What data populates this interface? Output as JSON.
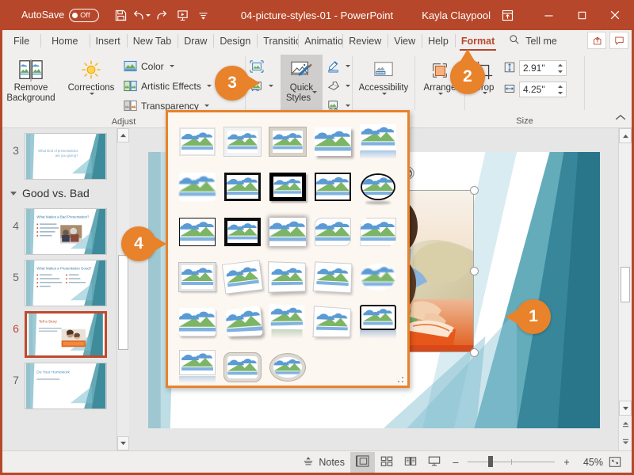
{
  "titlebar": {
    "autosave_label": "AutoSave",
    "autosave_state": "Off",
    "document_title": "04-picture-styles-01  -  PowerPoint",
    "user_name": "Kayla Claypool",
    "qat": [
      {
        "name": "save-icon",
        "label": "Save"
      },
      {
        "name": "undo-icon",
        "label": "Undo"
      },
      {
        "name": "redo-icon",
        "label": "Redo"
      },
      {
        "name": "start-slideshow-icon",
        "label": "Start From Beginning"
      },
      {
        "name": "customize-qat-icon",
        "label": "Customize Quick Access Toolbar"
      }
    ],
    "window_buttons": [
      {
        "name": "minimize-button",
        "glyph": "–"
      },
      {
        "name": "restore-button",
        "glyph": "☐"
      },
      {
        "name": "close-button",
        "glyph": "✕"
      }
    ],
    "ribbon_display_options": "ribbon-display-options-icon"
  },
  "tabs": [
    {
      "label": "File",
      "active": false
    },
    {
      "label": "Home",
      "active": false
    },
    {
      "label": "Insert",
      "active": false
    },
    {
      "label": "New Tab",
      "active": false
    },
    {
      "label": "Draw",
      "active": false
    },
    {
      "label": "Design",
      "active": false
    },
    {
      "label": "Transitions",
      "active": false
    },
    {
      "label": "Animations",
      "active": false
    },
    {
      "label": "Review",
      "active": false
    },
    {
      "label": "View",
      "active": false
    },
    {
      "label": "Help",
      "active": false
    },
    {
      "label": "Format",
      "active": true
    }
  ],
  "tellme": {
    "label": "Tell me",
    "icon": "search-icon"
  },
  "tab_right_buttons": [
    {
      "name": "share-button",
      "icon": "share-icon"
    },
    {
      "name": "comments-button",
      "icon": "comment-icon"
    }
  ],
  "ribbon": {
    "adjust": {
      "group_label": "Adjust",
      "remove_background": "Remove\nBackground",
      "remove_background_line1": "Remove",
      "remove_background_line2": "Background",
      "corrections": "Corrections",
      "items": [
        {
          "label": "Color",
          "icon": "color-icon",
          "has_caret": true
        },
        {
          "label": "Artistic Effects",
          "icon": "artistic-effects-icon",
          "has_caret": true
        },
        {
          "label": "Transparency",
          "icon": "transparency-icon",
          "has_caret": true
        }
      ]
    },
    "picture_styles": {
      "group_label": "",
      "quick_styles_line1": "Quick",
      "quick_styles_line2": "Styles",
      "left_icons": [
        {
          "name": "compress-pictures-icon"
        },
        {
          "name": "change-picture-icon"
        },
        {
          "name": "reset-picture-icon"
        }
      ],
      "right_icons": [
        {
          "name": "picture-border-icon",
          "has_caret": true
        },
        {
          "name": "picture-effects-icon",
          "has_caret": true
        },
        {
          "name": "picture-layout-icon",
          "has_caret": true
        }
      ]
    },
    "accessibility": {
      "label": "Accessibility",
      "icon": "accessibility-icon"
    },
    "arrange": {
      "label": "Arrange",
      "icon": "arrange-icon"
    },
    "size": {
      "group_label": "Size",
      "crop_label": "Crop",
      "crop_icon": "crop-icon",
      "height_value": "2.91\"",
      "height_icon": "shape-height-icon",
      "width_value": "4.25\"",
      "width_icon": "shape-width-icon",
      "dialog_launcher": "size-dialog-launcher"
    },
    "collapse_ribbon": "collapse-ribbon-icon"
  },
  "gallery": {
    "name": "picture-quick-styles-gallery",
    "items": [
      {
        "id": 1,
        "style": "simple-frame-white"
      },
      {
        "id": 2,
        "style": "beveled-matte-white"
      },
      {
        "id": 3,
        "style": "metal-frame"
      },
      {
        "id": 4,
        "style": "drop-shadow-rectangle"
      },
      {
        "id": 5,
        "style": "reflected-rounded-rectangle"
      },
      {
        "id": 6,
        "style": "soft-edge-rectangle"
      },
      {
        "id": 7,
        "style": "double-frame-black"
      },
      {
        "id": 8,
        "style": "thick-matte-black"
      },
      {
        "id": 9,
        "style": "simple-frame-black"
      },
      {
        "id": 10,
        "style": "beveled-oval-black"
      },
      {
        "id": 11,
        "style": "compound-frame-black"
      },
      {
        "id": 12,
        "style": "moderate-frame-black"
      },
      {
        "id": 13,
        "style": "center-shadow-rectangle"
      },
      {
        "id": 14,
        "style": "rounded-diagonal-corner-white"
      },
      {
        "id": 15,
        "style": "snip-diagonal-corner-white"
      },
      {
        "id": 16,
        "style": "moderate-frame-white"
      },
      {
        "id": 17,
        "style": "rotated-white"
      },
      {
        "id": 18,
        "style": "perspective-shadow-white"
      },
      {
        "id": 19,
        "style": "relaxed-perspective-white"
      },
      {
        "id": 20,
        "style": "soft-edge-oval"
      },
      {
        "id": 21,
        "style": "bevel-rectangle"
      },
      {
        "id": 22,
        "style": "bevel-perspective"
      },
      {
        "id": 23,
        "style": "reflected-perspective-right"
      },
      {
        "id": 24,
        "style": "bevel-perspective-left-white"
      },
      {
        "id": 25,
        "style": "reflected-bevel-black"
      },
      {
        "id": 26,
        "style": "reflected-bevel-white"
      },
      {
        "id": 27,
        "style": "metal-rounded-rectangle"
      },
      {
        "id": 28,
        "style": "metal-oval"
      }
    ]
  },
  "thumbnails": {
    "scroll_up": "scroll-up-arrow",
    "scroll_down": "scroll-down-arrow",
    "slides": [
      {
        "number": "3",
        "title": "What kind of presentations are you giving?",
        "selected": false,
        "type": "text-right"
      },
      {
        "number": "4",
        "title": "What Makes a Bad Presentation?",
        "selected": false,
        "type": "bullets-photo"
      },
      {
        "number": "5",
        "title": "What Makes a Presentation Good?",
        "selected": false,
        "type": "two-column-bullets"
      },
      {
        "number": "6",
        "title": "Tell a Story",
        "selected": true,
        "type": "title-photo"
      },
      {
        "number": "7",
        "title": "Do Your Homework",
        "selected": false,
        "type": "title-sub"
      }
    ],
    "section": {
      "label": "Good vs. Bad",
      "collapsed": false
    }
  },
  "slide": {
    "name": "slide-canvas",
    "selected_picture": {
      "name": "selected-picture",
      "alt": "mother and daughter reading a book",
      "rotate_handle": "rotate-handle"
    }
  },
  "status": {
    "notes_label": "Notes",
    "notes_icon": "notes-icon",
    "views": [
      {
        "name": "normal-view-button",
        "icon": "normal-view-icon",
        "active": true
      },
      {
        "name": "slide-sorter-button",
        "icon": "slide-sorter-icon",
        "active": false
      },
      {
        "name": "reading-view-button",
        "icon": "reading-view-icon",
        "active": false
      },
      {
        "name": "slideshow-button",
        "icon": "slideshow-icon",
        "active": false
      }
    ],
    "zoom_out": "–",
    "zoom_in": "+",
    "zoom_percent": "45%",
    "fit_to_window": "fit-slide-to-window-icon"
  },
  "callouts": [
    {
      "number": "1",
      "direction": "left",
      "target": "selected-picture"
    },
    {
      "number": "2",
      "direction": "up",
      "target": "format-tab"
    },
    {
      "number": "3",
      "direction": "right",
      "target": "quick-styles-button"
    },
    {
      "number": "4",
      "direction": "right",
      "target": "quick-styles-gallery"
    }
  ],
  "colors": {
    "brand": "#b7472a",
    "accent": "#e8822b",
    "ribbon_bg": "#f0efee",
    "selection": "#c0492b"
  }
}
